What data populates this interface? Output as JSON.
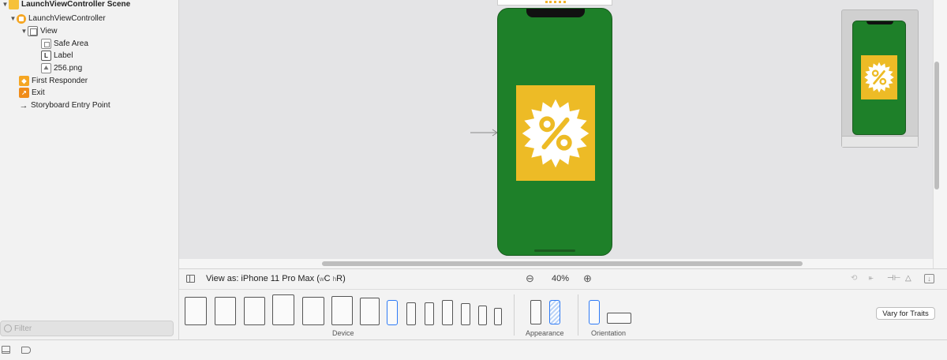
{
  "outline": {
    "items": [
      {
        "label": "LaunchViewController Scene",
        "icon": "scene-icon",
        "indent": 0,
        "expanded": true,
        "bold": true
      },
      {
        "label": "LaunchViewController",
        "icon": "view-controller-icon",
        "indent": 1,
        "expanded": true
      },
      {
        "label": "View",
        "icon": "view-icon",
        "indent": 2,
        "expanded": true
      },
      {
        "label": "Safe Area",
        "icon": "safe-area-icon",
        "indent": 3
      },
      {
        "label": "Label",
        "icon": "label-icon",
        "indent": 3
      },
      {
        "label": "256.png",
        "icon": "image-icon",
        "indent": 3
      },
      {
        "label": "First Responder",
        "icon": "first-responder-icon",
        "indent": 1
      },
      {
        "label": "Exit",
        "icon": "exit-icon",
        "indent": 1
      },
      {
        "label": "Storyboard Entry Point",
        "icon": "entry-point-arrow-icon",
        "indent": 1
      }
    ],
    "filter_placeholder": "Filter"
  },
  "canvas": {
    "phone_background": "#1e8029",
    "promo_color": "#edbb26",
    "promo_symbol": "%"
  },
  "device_bar": {
    "view_as_prefix": "View as: iPhone 11 Pro Max (",
    "view_as_w": "C",
    "view_as_h": "R",
    "view_as_suffix": ")",
    "zoom": "40%"
  },
  "devices": {
    "device_label": "Device",
    "appearance_label": "Appearance",
    "orientation_label": "Orientation",
    "vary_button": "Vary for Traits"
  },
  "colors": {
    "accent": "#2f7bf5"
  }
}
